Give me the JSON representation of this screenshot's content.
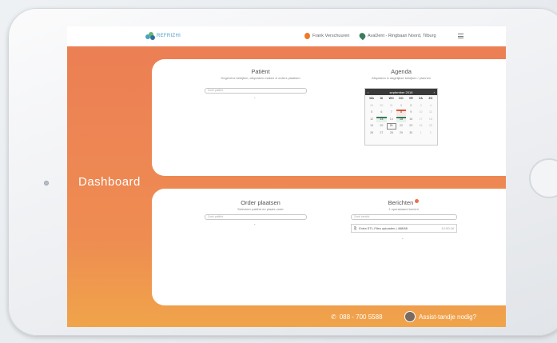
{
  "topbar": {
    "logo_text": "REFRIZHI",
    "user_name": "Frank Verschuuren",
    "location": "AvaDent - Ringbaan Noord, Tilburg"
  },
  "dashboard": {
    "title": "Dashboard"
  },
  "patient": {
    "title": "Patiënt",
    "subtitle": "Gegevens bekijken, afspraken maken & orders plaatsen",
    "search_placeholder": "Zoek patiënt"
  },
  "agenda": {
    "title": "Agenda",
    "subtitle": "Afspraken & dagelijkse bekijken / plannen",
    "month_label": "september 2016",
    "prev": "‹",
    "next": "›",
    "weekdays": [
      "MA",
      "DI",
      "WO",
      "DO",
      "VR",
      "ZA",
      "ZO"
    ],
    "weeks": [
      [
        "29",
        "30",
        "31",
        "1",
        "2",
        "3",
        "4"
      ],
      [
        "5",
        "6",
        "7",
        "8",
        "9",
        "10",
        "11"
      ],
      [
        "12",
        "13",
        "14",
        "15",
        "16",
        "17",
        "18"
      ],
      [
        "19",
        "20",
        "21",
        "22",
        "23",
        "24",
        "25"
      ],
      [
        "26",
        "27",
        "28",
        "29",
        "30",
        "1",
        "2"
      ]
    ]
  },
  "order": {
    "title": "Order plaatsen",
    "subtitle": "Selecteer patiënt en plaats order",
    "search_placeholder": "Zoek patiënt"
  },
  "messages": {
    "title": "Berichten",
    "subtitle": "1 openstaand bericht",
    "search_placeholder": "Zoek bericht",
    "items": [
      {
        "text": "Extra STL-Files uploaden | 468/88",
        "time": "12:00:16"
      }
    ]
  },
  "footer": {
    "phone": "088 - 700 5588",
    "assist": "Assist-tandje nodig?"
  },
  "colors": {
    "accent": "#ec7e55",
    "accent_light": "#f0a44a",
    "logo_blue": "#4aa0c8",
    "pin_green": "#3a7d5a",
    "user_orange": "#ec7a2a"
  }
}
